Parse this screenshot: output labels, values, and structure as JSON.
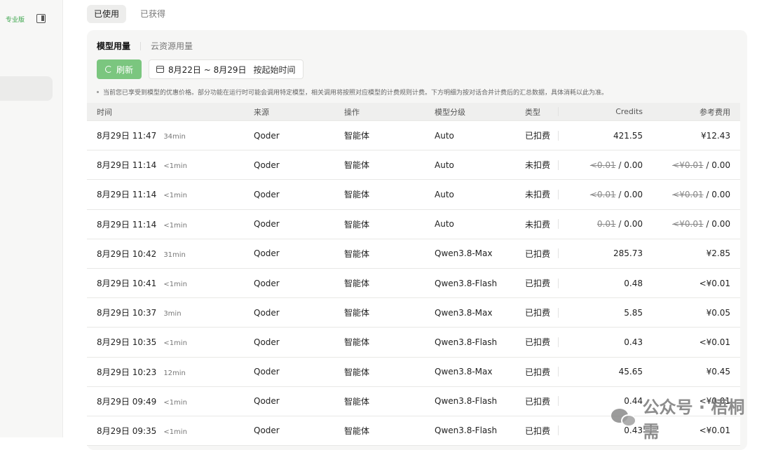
{
  "sidebar": {
    "plan_badge": "专业版"
  },
  "top_tabs": [
    {
      "label": "已使用",
      "active": true
    },
    {
      "label": "已获得",
      "active": false
    }
  ],
  "sub_tabs": [
    {
      "label": "模型用量",
      "active": true
    },
    {
      "label": "云资源用量",
      "active": false
    }
  ],
  "toolbar": {
    "refresh_label": "刷新",
    "date_range": "8月22日 ~ 8月29日",
    "date_sort": "按起始时间"
  },
  "notice": "当前您已享受到模型的优惠价格。部分功能在运行时可能会调用特定模型，相关调用将按照对应模型的计费规则计费。下方明细为按对话合并计费后的汇总数据，具体消耗以此为准。",
  "table": {
    "headers": {
      "time": "时间",
      "source": "来源",
      "action": "操作",
      "model": "模型分级",
      "type": "类型",
      "credits": "Credits",
      "cost": "参考费用"
    },
    "rows": [
      {
        "time": "8月29日 11:47",
        "duration": "34min",
        "source": "Qoder",
        "action": "智能体",
        "model": "Auto",
        "type": "已扣费",
        "credits_old": "",
        "credits": "421.55",
        "cost_old": "",
        "cost": "¥12.43"
      },
      {
        "time": "8月29日 11:14",
        "duration": "<1min",
        "source": "Qoder",
        "action": "智能体",
        "model": "Auto",
        "type": "未扣费",
        "credits_old": "<0.01",
        "credits": "0.00",
        "cost_old": "<¥0.01",
        "cost": "0.00"
      },
      {
        "time": "8月29日 11:14",
        "duration": "<1min",
        "source": "Qoder",
        "action": "智能体",
        "model": "Auto",
        "type": "未扣费",
        "credits_old": "<0.01",
        "credits": "0.00",
        "cost_old": "<¥0.01",
        "cost": "0.00"
      },
      {
        "time": "8月29日 11:14",
        "duration": "<1min",
        "source": "Qoder",
        "action": "智能体",
        "model": "Auto",
        "type": "未扣费",
        "credits_old": "0.01",
        "credits": "0.00",
        "cost_old": "<¥0.01",
        "cost": "0.00"
      },
      {
        "time": "8月29日 10:42",
        "duration": "31min",
        "source": "Qoder",
        "action": "智能体",
        "model": "Qwen3.8-Max",
        "type": "已扣费",
        "credits_old": "",
        "credits": "285.73",
        "cost_old": "",
        "cost": "¥2.85"
      },
      {
        "time": "8月29日 10:41",
        "duration": "<1min",
        "source": "Qoder",
        "action": "智能体",
        "model": "Qwen3.8-Flash",
        "type": "已扣费",
        "credits_old": "",
        "credits": "0.48",
        "cost_old": "",
        "cost": "<¥0.01"
      },
      {
        "time": "8月29日 10:37",
        "duration": "3min",
        "source": "Qoder",
        "action": "智能体",
        "model": "Qwen3.8-Max",
        "type": "已扣费",
        "credits_old": "",
        "credits": "5.85",
        "cost_old": "",
        "cost": "¥0.05"
      },
      {
        "time": "8月29日 10:35",
        "duration": "<1min",
        "source": "Qoder",
        "action": "智能体",
        "model": "Qwen3.8-Flash",
        "type": "已扣费",
        "credits_old": "",
        "credits": "0.43",
        "cost_old": "",
        "cost": "<¥0.01"
      },
      {
        "time": "8月29日 10:23",
        "duration": "12min",
        "source": "Qoder",
        "action": "智能体",
        "model": "Qwen3.8-Max",
        "type": "已扣费",
        "credits_old": "",
        "credits": "45.65",
        "cost_old": "",
        "cost": "¥0.45"
      },
      {
        "time": "8月29日 09:49",
        "duration": "<1min",
        "source": "Qoder",
        "action": "智能体",
        "model": "Qwen3.8-Flash",
        "type": "已扣费",
        "credits_old": "",
        "credits": "0.44",
        "cost_old": "",
        "cost": "<¥0.01"
      },
      {
        "time": "8月29日 09:35",
        "duration": "<1min",
        "source": "Qoder",
        "action": "智能体",
        "model": "Qwen3.8-Flash",
        "type": "已扣费",
        "credits_old": "",
        "credits": "0.43",
        "cost_old": "",
        "cost": "<¥0.01"
      }
    ]
  },
  "watermark": "公众号 · 梧桐需"
}
